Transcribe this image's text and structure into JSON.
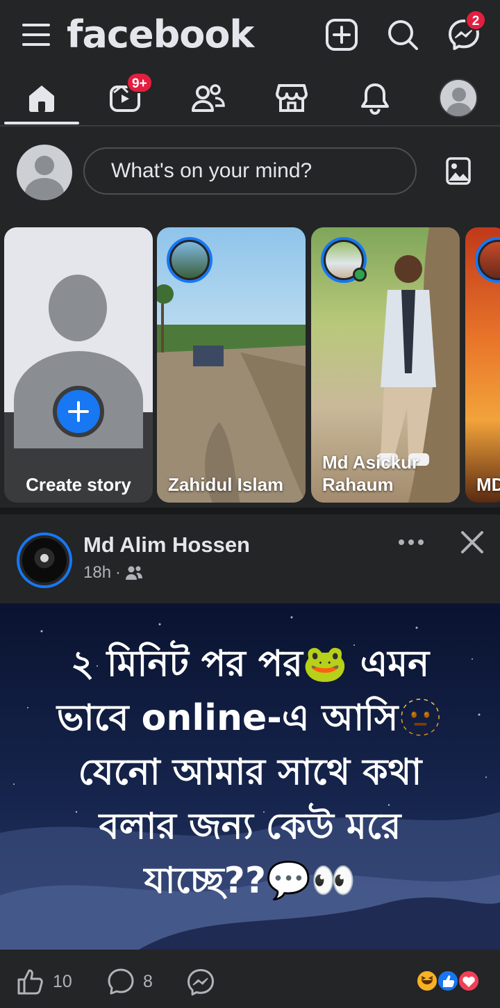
{
  "header": {
    "brand": "facebook",
    "messenger_badge": "2"
  },
  "nav": {
    "video_badge": "9+"
  },
  "composer": {
    "placeholder": "What's on your mind?"
  },
  "stories": [
    {
      "name": "Create story"
    },
    {
      "name": "Zahidul Islam"
    },
    {
      "name": "Md Asickur Rahaum"
    },
    {
      "name": "MD"
    }
  ],
  "post": {
    "author": "Md Alim Hossen",
    "time": "18h",
    "separator": "·",
    "text_lines": [
      "২ মিনিট পর পর🐸 এমন",
      "ভাবে online-এ আসি🫥",
      "যেনো আমার সাথে কথা",
      "বলার জন্য কেউ মরে",
      "যাচ্ছে??💬👀"
    ],
    "likes": "10",
    "comments": "8"
  },
  "colors": {
    "accent": "#1877f2",
    "badge": "#e41e3f",
    "bg": "#242526"
  }
}
